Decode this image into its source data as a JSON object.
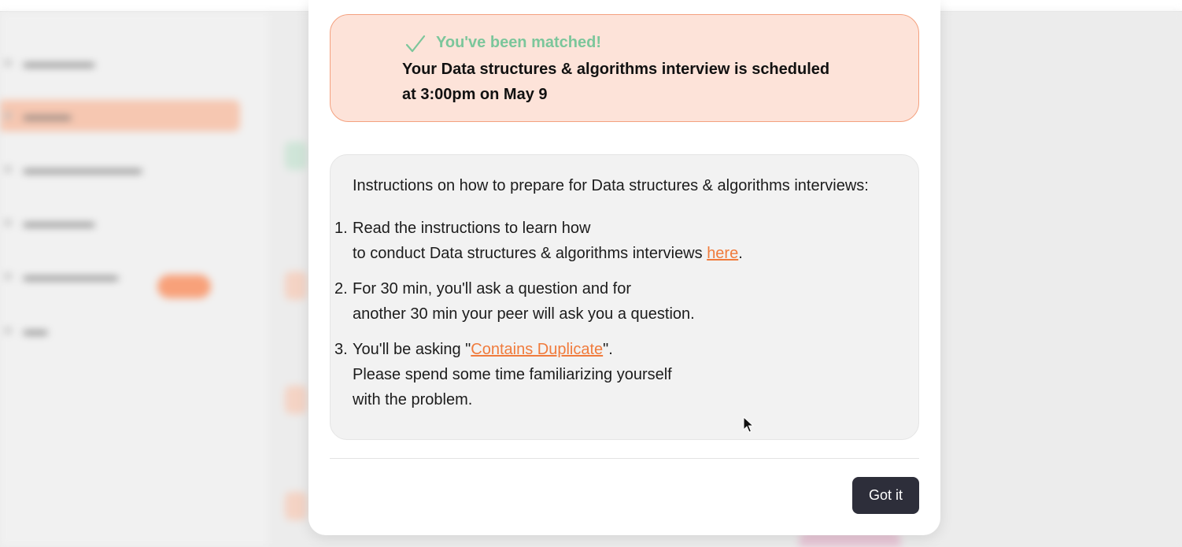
{
  "match": {
    "title": "You've been matched!",
    "line1": "Your Data structures & algorithms interview is scheduled",
    "line2": "at 3:00pm on May 9"
  },
  "instructions": {
    "heading": "Instructions on how to prepare for Data structures & algorithms interviews:",
    "steps": [
      {
        "number": "1.",
        "line1": "Read the instructions to learn how",
        "line2_text": "to conduct Data structures & algorithms interviews ",
        "link": "here",
        "line2_end": "."
      },
      {
        "number": "2.",
        "line1": "For 30 min, you'll ask a question and for",
        "line2": "another 30 min your peer will ask you a question."
      },
      {
        "number": "3.",
        "line1_text": "You'll be asking \"",
        "link": "Contains Duplicate",
        "line1_end": "\".",
        "line2": "Please spend some time familiarizing yourself",
        "line3": "with the problem."
      }
    ]
  },
  "footer": {
    "button_label": "Got it"
  },
  "icons": {
    "check": "check-icon",
    "cursor": "mouse-cursor-icon"
  },
  "colors": {
    "banner_background": "#fde3d9",
    "banner_border": "#f4a17f",
    "success_green": "#7cc69b",
    "link_orange": "#f07b3c",
    "button_dark": "#2d2e3a"
  }
}
